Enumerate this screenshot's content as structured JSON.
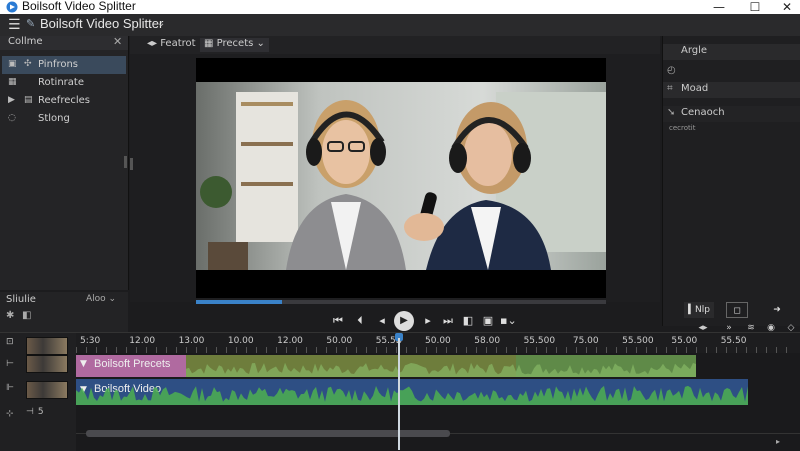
{
  "window": {
    "title": "Boilsoft Video Splitter",
    "controls": [
      "—",
      "☐",
      "✕"
    ]
  },
  "menubar": {
    "project": "Boilsoft Video Splitter",
    "caret": "⌄"
  },
  "left_panel": {
    "header": "Collme",
    "items": [
      {
        "label": "Pinfrons",
        "selected": true
      },
      {
        "label": "Rotinrate",
        "selected": false
      },
      {
        "label": "Reefrecles",
        "selected": false
      },
      {
        "label": "Stlong",
        "selected": false
      }
    ]
  },
  "left_lower": {
    "label": "Sliulie",
    "selector": "Aloo"
  },
  "tabs": [
    {
      "label": "Featrot",
      "active": false
    },
    {
      "label": "Precets",
      "active": true
    }
  ],
  "playback": {
    "progress_fraction": 0.21
  },
  "right_panel": {
    "sections": [
      {
        "label": "Argle",
        "icon": ""
      },
      {
        "label": "",
        "icon": "clock-icon"
      },
      {
        "label": "Moad",
        "icon": "crop-icon"
      },
      {
        "label": "Cenaoch",
        "icon": "cursor-icon"
      }
    ],
    "sub_label": "cecrotit",
    "nav_label": "Nlp"
  },
  "timeline": {
    "ticks": [
      "5:30",
      "12.00",
      "13.00",
      "10.00",
      "12.00",
      "50.00",
      "55.5B",
      "50.00",
      "58.00",
      "55.500",
      "75.00",
      "55.500",
      "55.00",
      "55.50"
    ],
    "track1_label": "Boilsoft Precets",
    "track2_label": "Boilsoft Video",
    "track3_label": "5"
  },
  "colors": {
    "accent": "#3a82c8",
    "clip_pink": "#b06aa0",
    "clip_olive": "#7a8f3a",
    "clip_blue": "#3a5a8c",
    "wave_green": "#4caf50"
  }
}
